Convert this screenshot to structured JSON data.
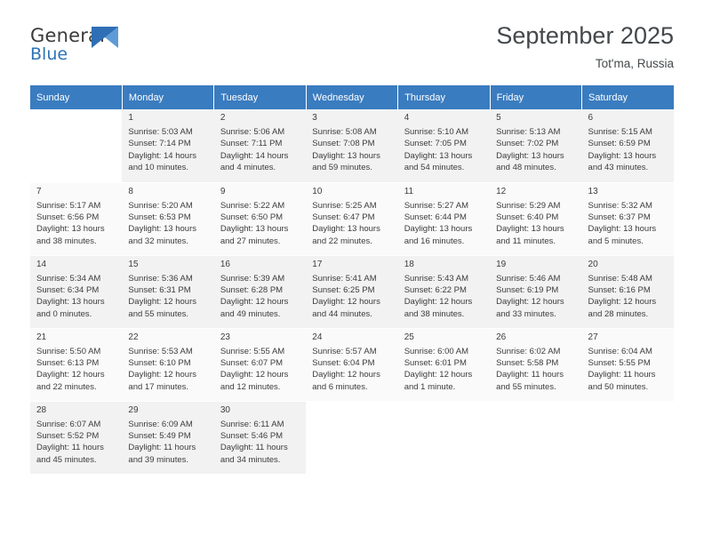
{
  "brand": {
    "name_top": "General",
    "name_bottom": "Blue",
    "flag_icon": "flag-icon",
    "accent_dark": "#2f6fb5",
    "accent_light": "#5e9bd6"
  },
  "header": {
    "title": "September 2025",
    "location": "Tot'ma, Russia"
  },
  "colors": {
    "header_row_bg": "#3a7cc0",
    "row_odd_bg": "#f2f2f2",
    "row_even_bg": "#fafafa",
    "text": "#3c3c3c"
  },
  "weekdays": [
    "Sunday",
    "Monday",
    "Tuesday",
    "Wednesday",
    "Thursday",
    "Friday",
    "Saturday"
  ],
  "weeks": [
    [
      {
        "day": "",
        "sunrise": "",
        "sunset": "",
        "daylight1": "",
        "daylight2": "",
        "empty": true
      },
      {
        "day": "1",
        "sunrise": "Sunrise: 5:03 AM",
        "sunset": "Sunset: 7:14 PM",
        "daylight1": "Daylight: 14 hours",
        "daylight2": "and 10 minutes."
      },
      {
        "day": "2",
        "sunrise": "Sunrise: 5:06 AM",
        "sunset": "Sunset: 7:11 PM",
        "daylight1": "Daylight: 14 hours",
        "daylight2": "and 4 minutes."
      },
      {
        "day": "3",
        "sunrise": "Sunrise: 5:08 AM",
        "sunset": "Sunset: 7:08 PM",
        "daylight1": "Daylight: 13 hours",
        "daylight2": "and 59 minutes."
      },
      {
        "day": "4",
        "sunrise": "Sunrise: 5:10 AM",
        "sunset": "Sunset: 7:05 PM",
        "daylight1": "Daylight: 13 hours",
        "daylight2": "and 54 minutes."
      },
      {
        "day": "5",
        "sunrise": "Sunrise: 5:13 AM",
        "sunset": "Sunset: 7:02 PM",
        "daylight1": "Daylight: 13 hours",
        "daylight2": "and 48 minutes."
      },
      {
        "day": "6",
        "sunrise": "Sunrise: 5:15 AM",
        "sunset": "Sunset: 6:59 PM",
        "daylight1": "Daylight: 13 hours",
        "daylight2": "and 43 minutes."
      }
    ],
    [
      {
        "day": "7",
        "sunrise": "Sunrise: 5:17 AM",
        "sunset": "Sunset: 6:56 PM",
        "daylight1": "Daylight: 13 hours",
        "daylight2": "and 38 minutes."
      },
      {
        "day": "8",
        "sunrise": "Sunrise: 5:20 AM",
        "sunset": "Sunset: 6:53 PM",
        "daylight1": "Daylight: 13 hours",
        "daylight2": "and 32 minutes."
      },
      {
        "day": "9",
        "sunrise": "Sunrise: 5:22 AM",
        "sunset": "Sunset: 6:50 PM",
        "daylight1": "Daylight: 13 hours",
        "daylight2": "and 27 minutes."
      },
      {
        "day": "10",
        "sunrise": "Sunrise: 5:25 AM",
        "sunset": "Sunset: 6:47 PM",
        "daylight1": "Daylight: 13 hours",
        "daylight2": "and 22 minutes."
      },
      {
        "day": "11",
        "sunrise": "Sunrise: 5:27 AM",
        "sunset": "Sunset: 6:44 PM",
        "daylight1": "Daylight: 13 hours",
        "daylight2": "and 16 minutes."
      },
      {
        "day": "12",
        "sunrise": "Sunrise: 5:29 AM",
        "sunset": "Sunset: 6:40 PM",
        "daylight1": "Daylight: 13 hours",
        "daylight2": "and 11 minutes."
      },
      {
        "day": "13",
        "sunrise": "Sunrise: 5:32 AM",
        "sunset": "Sunset: 6:37 PM",
        "daylight1": "Daylight: 13 hours",
        "daylight2": "and 5 minutes."
      }
    ],
    [
      {
        "day": "14",
        "sunrise": "Sunrise: 5:34 AM",
        "sunset": "Sunset: 6:34 PM",
        "daylight1": "Daylight: 13 hours",
        "daylight2": "and 0 minutes."
      },
      {
        "day": "15",
        "sunrise": "Sunrise: 5:36 AM",
        "sunset": "Sunset: 6:31 PM",
        "daylight1": "Daylight: 12 hours",
        "daylight2": "and 55 minutes."
      },
      {
        "day": "16",
        "sunrise": "Sunrise: 5:39 AM",
        "sunset": "Sunset: 6:28 PM",
        "daylight1": "Daylight: 12 hours",
        "daylight2": "and 49 minutes."
      },
      {
        "day": "17",
        "sunrise": "Sunrise: 5:41 AM",
        "sunset": "Sunset: 6:25 PM",
        "daylight1": "Daylight: 12 hours",
        "daylight2": "and 44 minutes."
      },
      {
        "day": "18",
        "sunrise": "Sunrise: 5:43 AM",
        "sunset": "Sunset: 6:22 PM",
        "daylight1": "Daylight: 12 hours",
        "daylight2": "and 38 minutes."
      },
      {
        "day": "19",
        "sunrise": "Sunrise: 5:46 AM",
        "sunset": "Sunset: 6:19 PM",
        "daylight1": "Daylight: 12 hours",
        "daylight2": "and 33 minutes."
      },
      {
        "day": "20",
        "sunrise": "Sunrise: 5:48 AM",
        "sunset": "Sunset: 6:16 PM",
        "daylight1": "Daylight: 12 hours",
        "daylight2": "and 28 minutes."
      }
    ],
    [
      {
        "day": "21",
        "sunrise": "Sunrise: 5:50 AM",
        "sunset": "Sunset: 6:13 PM",
        "daylight1": "Daylight: 12 hours",
        "daylight2": "and 22 minutes."
      },
      {
        "day": "22",
        "sunrise": "Sunrise: 5:53 AM",
        "sunset": "Sunset: 6:10 PM",
        "daylight1": "Daylight: 12 hours",
        "daylight2": "and 17 minutes."
      },
      {
        "day": "23",
        "sunrise": "Sunrise: 5:55 AM",
        "sunset": "Sunset: 6:07 PM",
        "daylight1": "Daylight: 12 hours",
        "daylight2": "and 12 minutes."
      },
      {
        "day": "24",
        "sunrise": "Sunrise: 5:57 AM",
        "sunset": "Sunset: 6:04 PM",
        "daylight1": "Daylight: 12 hours",
        "daylight2": "and 6 minutes."
      },
      {
        "day": "25",
        "sunrise": "Sunrise: 6:00 AM",
        "sunset": "Sunset: 6:01 PM",
        "daylight1": "Daylight: 12 hours",
        "daylight2": "and 1 minute."
      },
      {
        "day": "26",
        "sunrise": "Sunrise: 6:02 AM",
        "sunset": "Sunset: 5:58 PM",
        "daylight1": "Daylight: 11 hours",
        "daylight2": "and 55 minutes."
      },
      {
        "day": "27",
        "sunrise": "Sunrise: 6:04 AM",
        "sunset": "Sunset: 5:55 PM",
        "daylight1": "Daylight: 11 hours",
        "daylight2": "and 50 minutes."
      }
    ],
    [
      {
        "day": "28",
        "sunrise": "Sunrise: 6:07 AM",
        "sunset": "Sunset: 5:52 PM",
        "daylight1": "Daylight: 11 hours",
        "daylight2": "and 45 minutes."
      },
      {
        "day": "29",
        "sunrise": "Sunrise: 6:09 AM",
        "sunset": "Sunset: 5:49 PM",
        "daylight1": "Daylight: 11 hours",
        "daylight2": "and 39 minutes."
      },
      {
        "day": "30",
        "sunrise": "Sunrise: 6:11 AM",
        "sunset": "Sunset: 5:46 PM",
        "daylight1": "Daylight: 11 hours",
        "daylight2": "and 34 minutes."
      },
      {
        "day": "",
        "sunrise": "",
        "sunset": "",
        "daylight1": "",
        "daylight2": "",
        "empty": true
      },
      {
        "day": "",
        "sunrise": "",
        "sunset": "",
        "daylight1": "",
        "daylight2": "",
        "empty": true
      },
      {
        "day": "",
        "sunrise": "",
        "sunset": "",
        "daylight1": "",
        "daylight2": "",
        "empty": true
      },
      {
        "day": "",
        "sunrise": "",
        "sunset": "",
        "daylight1": "",
        "daylight2": "",
        "empty": true
      }
    ]
  ]
}
